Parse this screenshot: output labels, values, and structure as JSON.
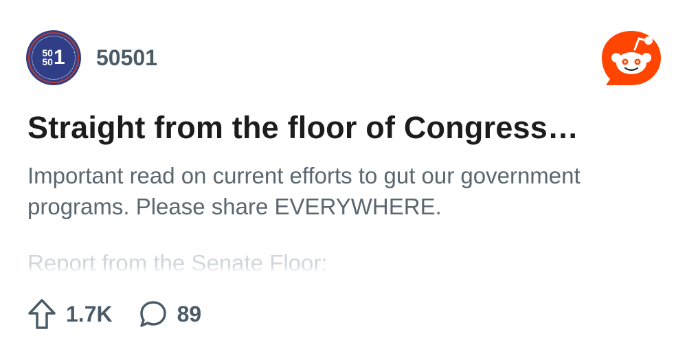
{
  "subreddit": {
    "name": "50501",
    "avatar_text_top": "50",
    "avatar_text_bottom": "50",
    "avatar_text_big": "1",
    "avatar_color": "#2f3e87"
  },
  "brand": {
    "logo_icon": "reddit-logo-icon",
    "color": "#ff4500"
  },
  "post": {
    "title": "Straight from the floor of Congress…",
    "body": "Important read on current efforts to gut our government programs. Please share EVERYWHERE.",
    "preview_line": "Report from the Senate Floor:"
  },
  "actions": {
    "upvote_icon": "upvote-arrow-icon",
    "upvotes": "1.7K",
    "comment_icon": "comment-bubble-icon",
    "comments": "89"
  }
}
